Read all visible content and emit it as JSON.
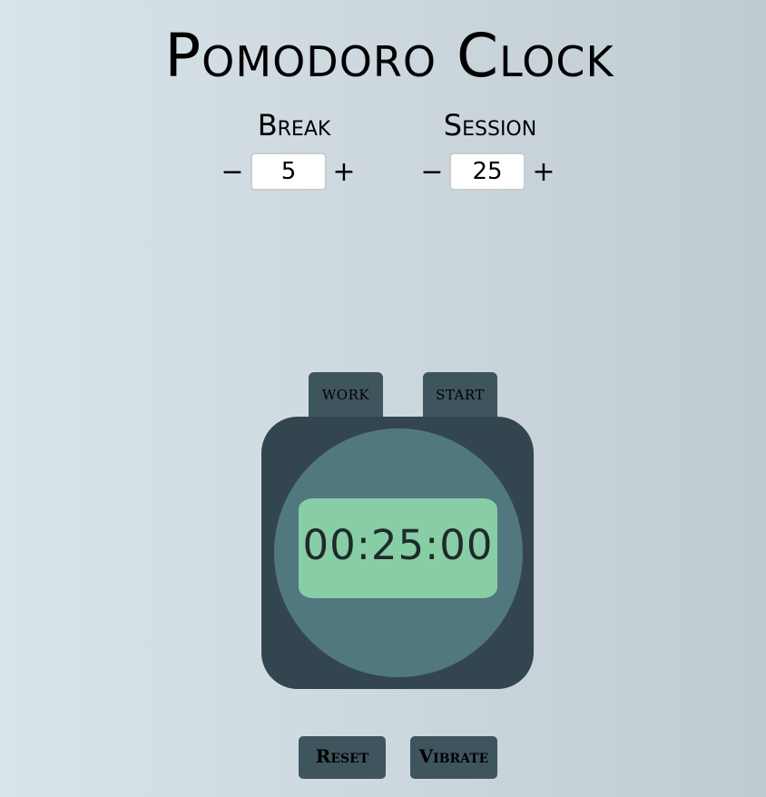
{
  "app": {
    "title": "Pomodoro Clock"
  },
  "break": {
    "label": "Break",
    "decrement": "−",
    "value": "5",
    "increment": "+"
  },
  "session": {
    "label": "Session",
    "decrement": "−",
    "value": "25",
    "increment": "+"
  },
  "timer": {
    "mode_label": "WORK",
    "start_label": "START",
    "display": "00:25:00"
  },
  "controls": {
    "reset_label": "Reset",
    "vibrate_label": "Vibrate"
  },
  "colors": {
    "watch_body": "#33464f",
    "watch_face": "#52787f",
    "display_bg": "#87cda5",
    "button_bg": "#3e555e"
  },
  "icons": {
    "decrement": "minus-icon",
    "increment": "plus-icon"
  }
}
